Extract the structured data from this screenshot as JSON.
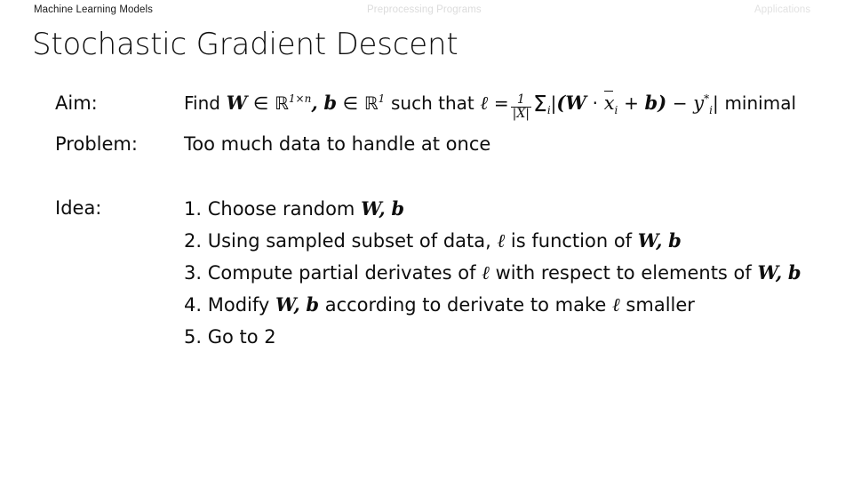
{
  "nav": {
    "items": [
      {
        "label": "Machine Learning Models",
        "state": "active"
      },
      {
        "label": "Preprocessing Programs",
        "state": "inactive"
      },
      {
        "label": "Applications",
        "state": "inactive"
      }
    ],
    "active_color": "#1a1a1a",
    "inactive_color": "#dcdcdc"
  },
  "slide": {
    "title": "Stochastic Gradient Descent",
    "background_color": "#ffffff",
    "text_color": "#0d0d0d"
  },
  "body": {
    "aim": {
      "label": "Aim:",
      "text_plain": "Find W ∈ ℝ^{1×n}, b ∈ ℝ^1 such that ℓ = 1/|X| Σ_i |(W · x̄_i + b) − y*_i| minimal",
      "parts": {
        "find": "Find",
        "w": "W",
        "in1": "∈",
        "r1": "ℝ",
        "exp1": "1×n",
        "comma1": ",",
        "b": "b",
        "in2": "∈",
        "r2": "ℝ",
        "exp2": "1",
        "suchthat": "such that",
        "ell": "ℓ",
        "eq": "=",
        "frac_num": "1",
        "frac_den": "|X|",
        "sigma": "Σ",
        "sigma_sub": "i",
        "bar1": "|",
        "open": "(",
        "w2": "W",
        "dot": "·",
        "xbar": "x",
        "x_sub": "i",
        "plus": "+",
        "b2": "b",
        "close": ")",
        "minus": "−",
        "y": "y",
        "y_sup": "*",
        "y_sub": "i",
        "bar2": "|",
        "minimal": "minimal"
      }
    },
    "problem": {
      "label": "Problem:",
      "text": "Too much data to handle at once"
    },
    "idea": {
      "label": "Idea:",
      "steps": [
        {
          "number": "1.",
          "text_plain": "Choose random W, b",
          "parts": {
            "lead": "Choose random",
            "v1": "W",
            "sep": ",",
            "v2": "b"
          }
        },
        {
          "number": "2.",
          "text_plain": "Using sampled subset of data, ℓ is function of W, b",
          "parts": {
            "lead": "Using sampled subset of data,",
            "ell": "ℓ",
            "mid": "is function of",
            "v1": "W",
            "sep": ",",
            "v2": "b"
          }
        },
        {
          "number": "3.",
          "text_plain": "Compute partial derivates of ℓ with respect to elements of W, b",
          "parts": {
            "lead": "Compute partial derivates of",
            "ell": "ℓ",
            "mid": "with respect to elements of",
            "v1": "W",
            "sep": ",",
            "v2": "b"
          }
        },
        {
          "number": "4.",
          "text_plain": "Modify W, b according to derivate to make ℓ smaller",
          "parts": {
            "lead": "Modify",
            "v1": "W",
            "sep": ",",
            "v2": "b",
            "mid": "according to derivate to make",
            "ell": "ℓ",
            "tail": "smaller"
          }
        },
        {
          "number": "5.",
          "text_plain": "Go to 2",
          "parts": {
            "lead": "Go to 2"
          }
        }
      ]
    }
  }
}
